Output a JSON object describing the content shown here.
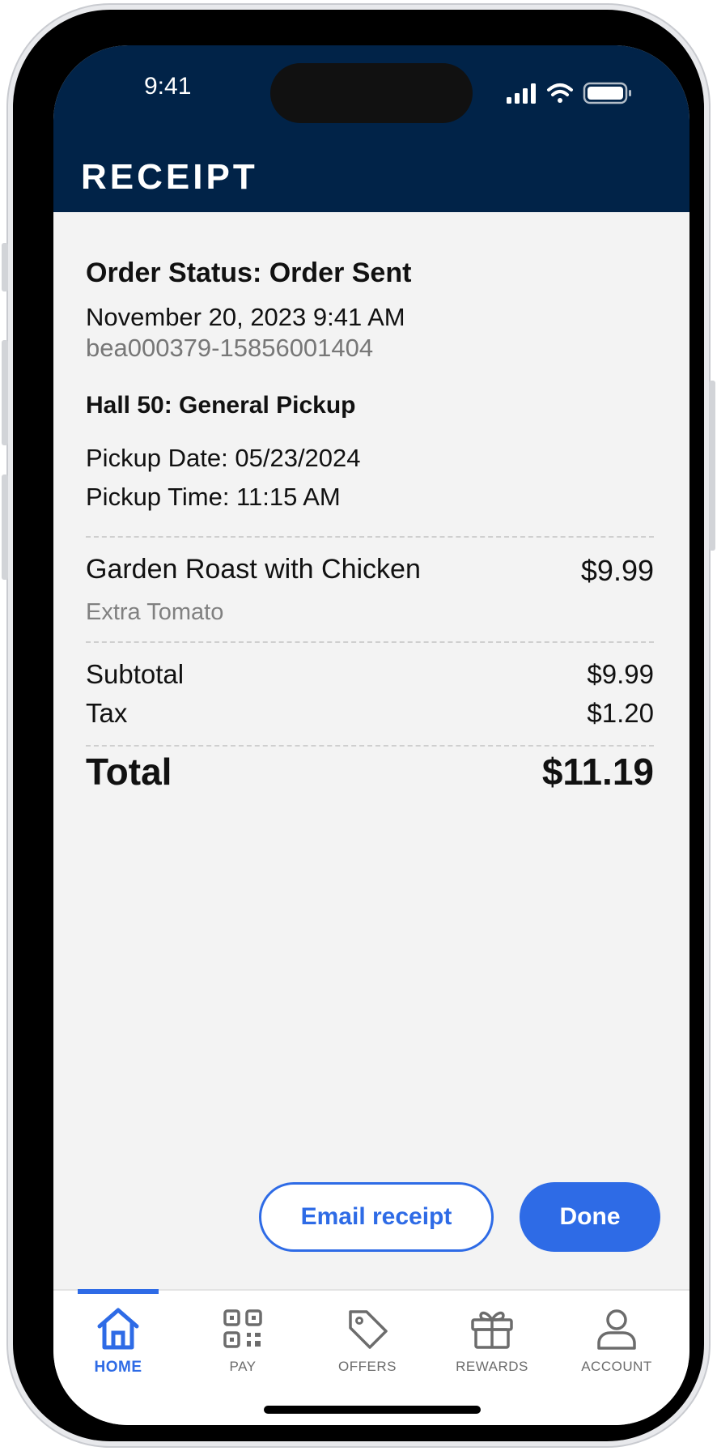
{
  "status_bar": {
    "time": "9:41"
  },
  "header": {
    "title": "RECEIPT"
  },
  "order": {
    "status": "Order Status: Order Sent",
    "datetime": "November 20, 2023 9:41 AM",
    "order_id": "bea000379-15856001404",
    "location": "Hall 50: General Pickup",
    "pickup_date": "Pickup Date: 05/23/2024",
    "pickup_time": "Pickup Time: 11:15 AM"
  },
  "items": [
    {
      "name": "Garden Roast with Chicken",
      "price": "$9.99",
      "modifier": "Extra Tomato"
    }
  ],
  "summary": {
    "subtotal_label": "Subtotal",
    "subtotal": "$9.99",
    "tax_label": "Tax",
    "tax": "$1.20",
    "total_label": "Total",
    "total": "$11.19"
  },
  "actions": {
    "email_label": "Email receipt",
    "done_label": "Done"
  },
  "tabs": [
    {
      "label": "HOME",
      "icon": "home-icon",
      "active": true
    },
    {
      "label": "PAY",
      "icon": "qr-code-icon",
      "active": false
    },
    {
      "label": "OFFERS",
      "icon": "tag-icon",
      "active": false
    },
    {
      "label": "REWARDS",
      "icon": "gift-icon",
      "active": false
    },
    {
      "label": "ACCOUNT",
      "icon": "person-icon",
      "active": false
    }
  ],
  "colors": {
    "header_bg": "#012348",
    "accent": "#2e6be6",
    "page_bg": "#f3f3f3"
  }
}
